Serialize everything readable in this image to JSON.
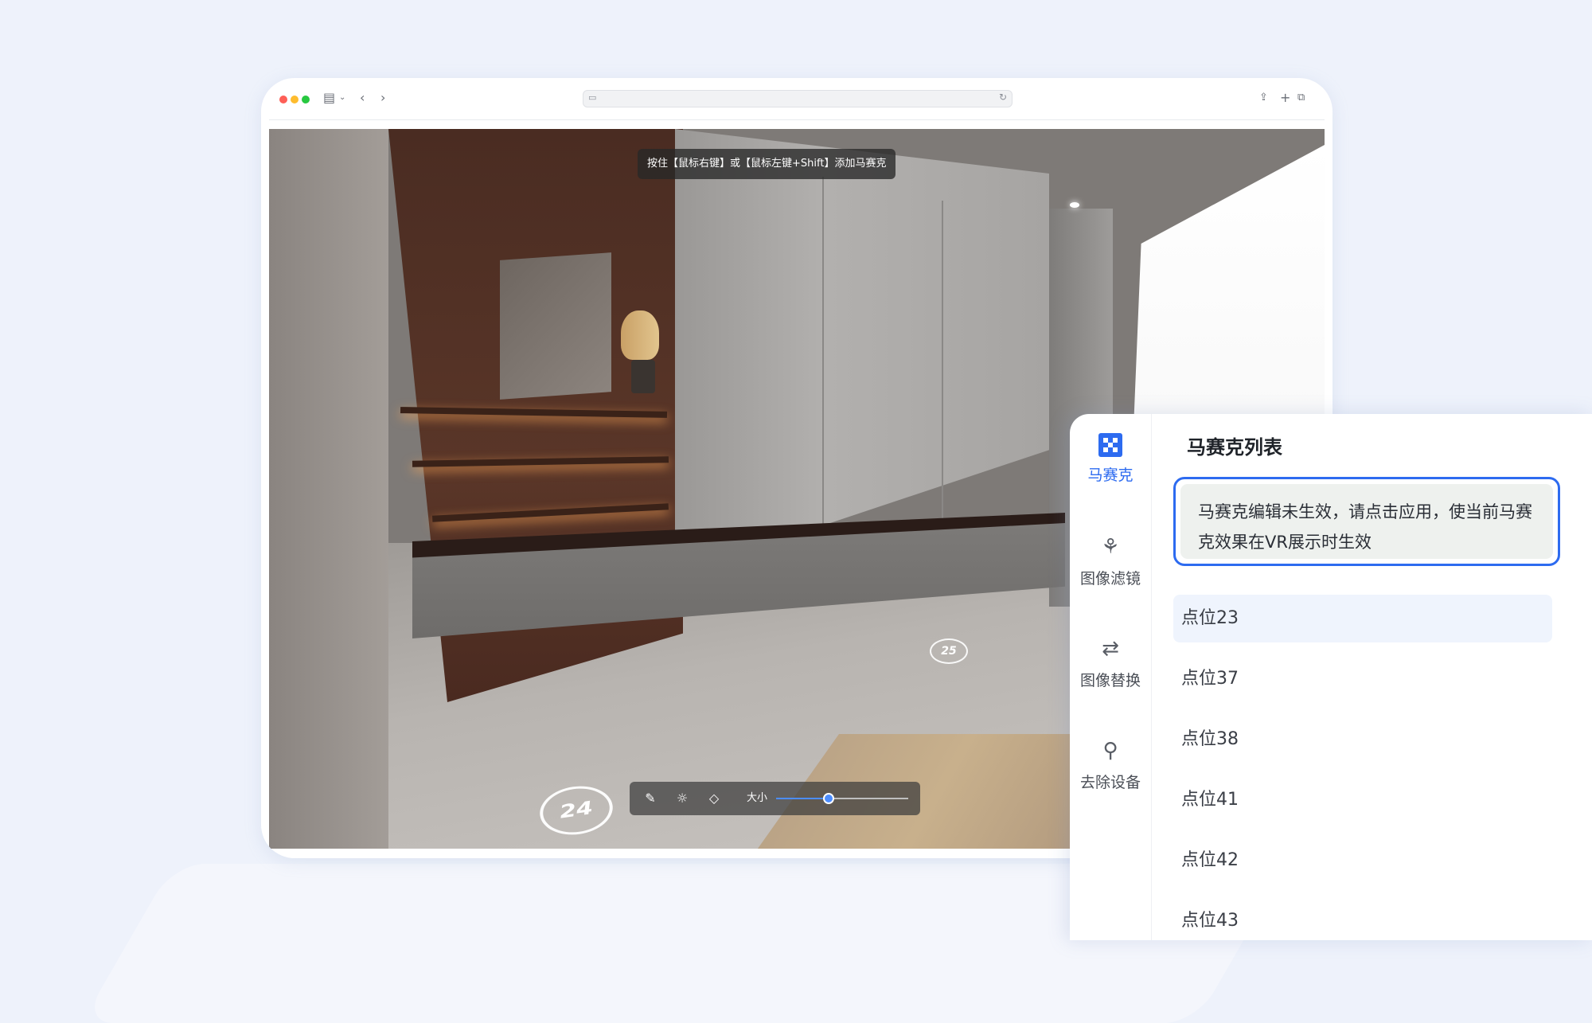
{
  "viewer": {
    "hint": "按住【鼠标右键】或【鼠标左键+Shift】添加马赛克",
    "marker_near": "24",
    "marker_far": "25",
    "toolbar": {
      "brush_icon": "brush-icon",
      "brightness_icon": "sun-icon",
      "eraser_icon": "eraser-icon",
      "size_label": "大小",
      "size_value": 0.4
    }
  },
  "panel": {
    "nav": [
      {
        "label": "马赛克",
        "icon": "mosaic-icon",
        "active": true
      },
      {
        "label": "图像滤镜",
        "icon": "filter-icon",
        "active": false
      },
      {
        "label": "图像替换",
        "icon": "replace-icon",
        "active": false
      },
      {
        "label": "去除设备",
        "icon": "remove-device-icon",
        "active": false
      }
    ],
    "title": "马赛克列表",
    "notice": "马赛克编辑未生效，请点击应用，使当前马赛克效果在VR展示时生效",
    "points": [
      "点位23",
      "点位37",
      "点位38",
      "点位41",
      "点位42",
      "点位43"
    ],
    "active_point": 0
  },
  "colors": {
    "accent": "#2d6bf0",
    "background": "#eef2fb"
  }
}
